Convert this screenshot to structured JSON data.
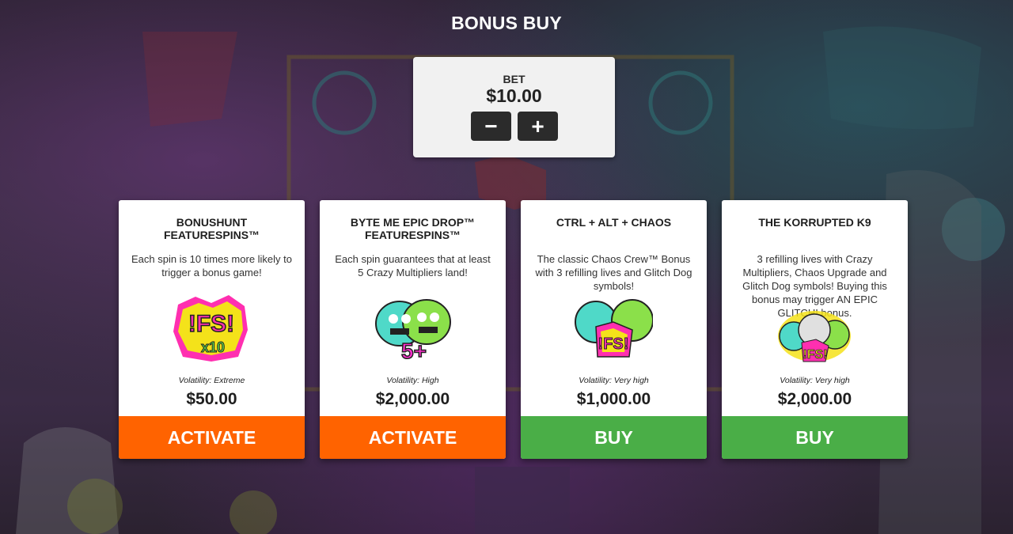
{
  "header": {
    "title": "BONUS BUY"
  },
  "bet": {
    "label": "BET",
    "value": "$10.00",
    "decrease_symbol": "−",
    "increase_symbol": "+"
  },
  "colors": {
    "activate_button": "#ff6300",
    "buy_button": "#4aae47",
    "card_background": "#ffffff",
    "bet_panel": "#f1f1f1"
  },
  "cards": [
    {
      "title": "BONUSHUNT FEATURESPINS™",
      "description": "Each spin is 10 times more likely to trigger a bonus game!",
      "icon": "fs-x10-icon",
      "icon_text": "!FS!",
      "icon_subtext": "x10",
      "volatility": "Volatility: Extreme",
      "price": "$50.00",
      "button_label": "ACTIVATE"
    },
    {
      "title": "BYTE ME EPIC DROP™ FEATURESPINS™",
      "description": "Each spin guarantees that at least 5 Crazy Multipliers land!",
      "icon": "twin-monsters-5plus-icon",
      "icon_text": "5+",
      "volatility": "Volatility: High",
      "price": "$2,000.00",
      "button_label": "ACTIVATE"
    },
    {
      "title": "CTRL + ALT + CHAOS",
      "description": "The classic Chaos Crew™ Bonus with 3 refilling lives and Glitch Dog symbols!",
      "icon": "monsters-fs-icon",
      "icon_text": "!FS!",
      "volatility": "Volatility: Very high",
      "price": "$1,000.00",
      "button_label": "BUY"
    },
    {
      "title": "THE KORRUPTED K9",
      "description": "3 refilling lives with Crazy Multipliers, Chaos Upgrade and Glitch Dog symbols! Buying this bonus may trigger AN EPIC GLITCH! bonus.",
      "icon": "korrupted-k9-fs-icon",
      "icon_text": "!FS!",
      "volatility": "Volatility: Very high",
      "price": "$2,000.00",
      "button_label": "BUY"
    }
  ]
}
